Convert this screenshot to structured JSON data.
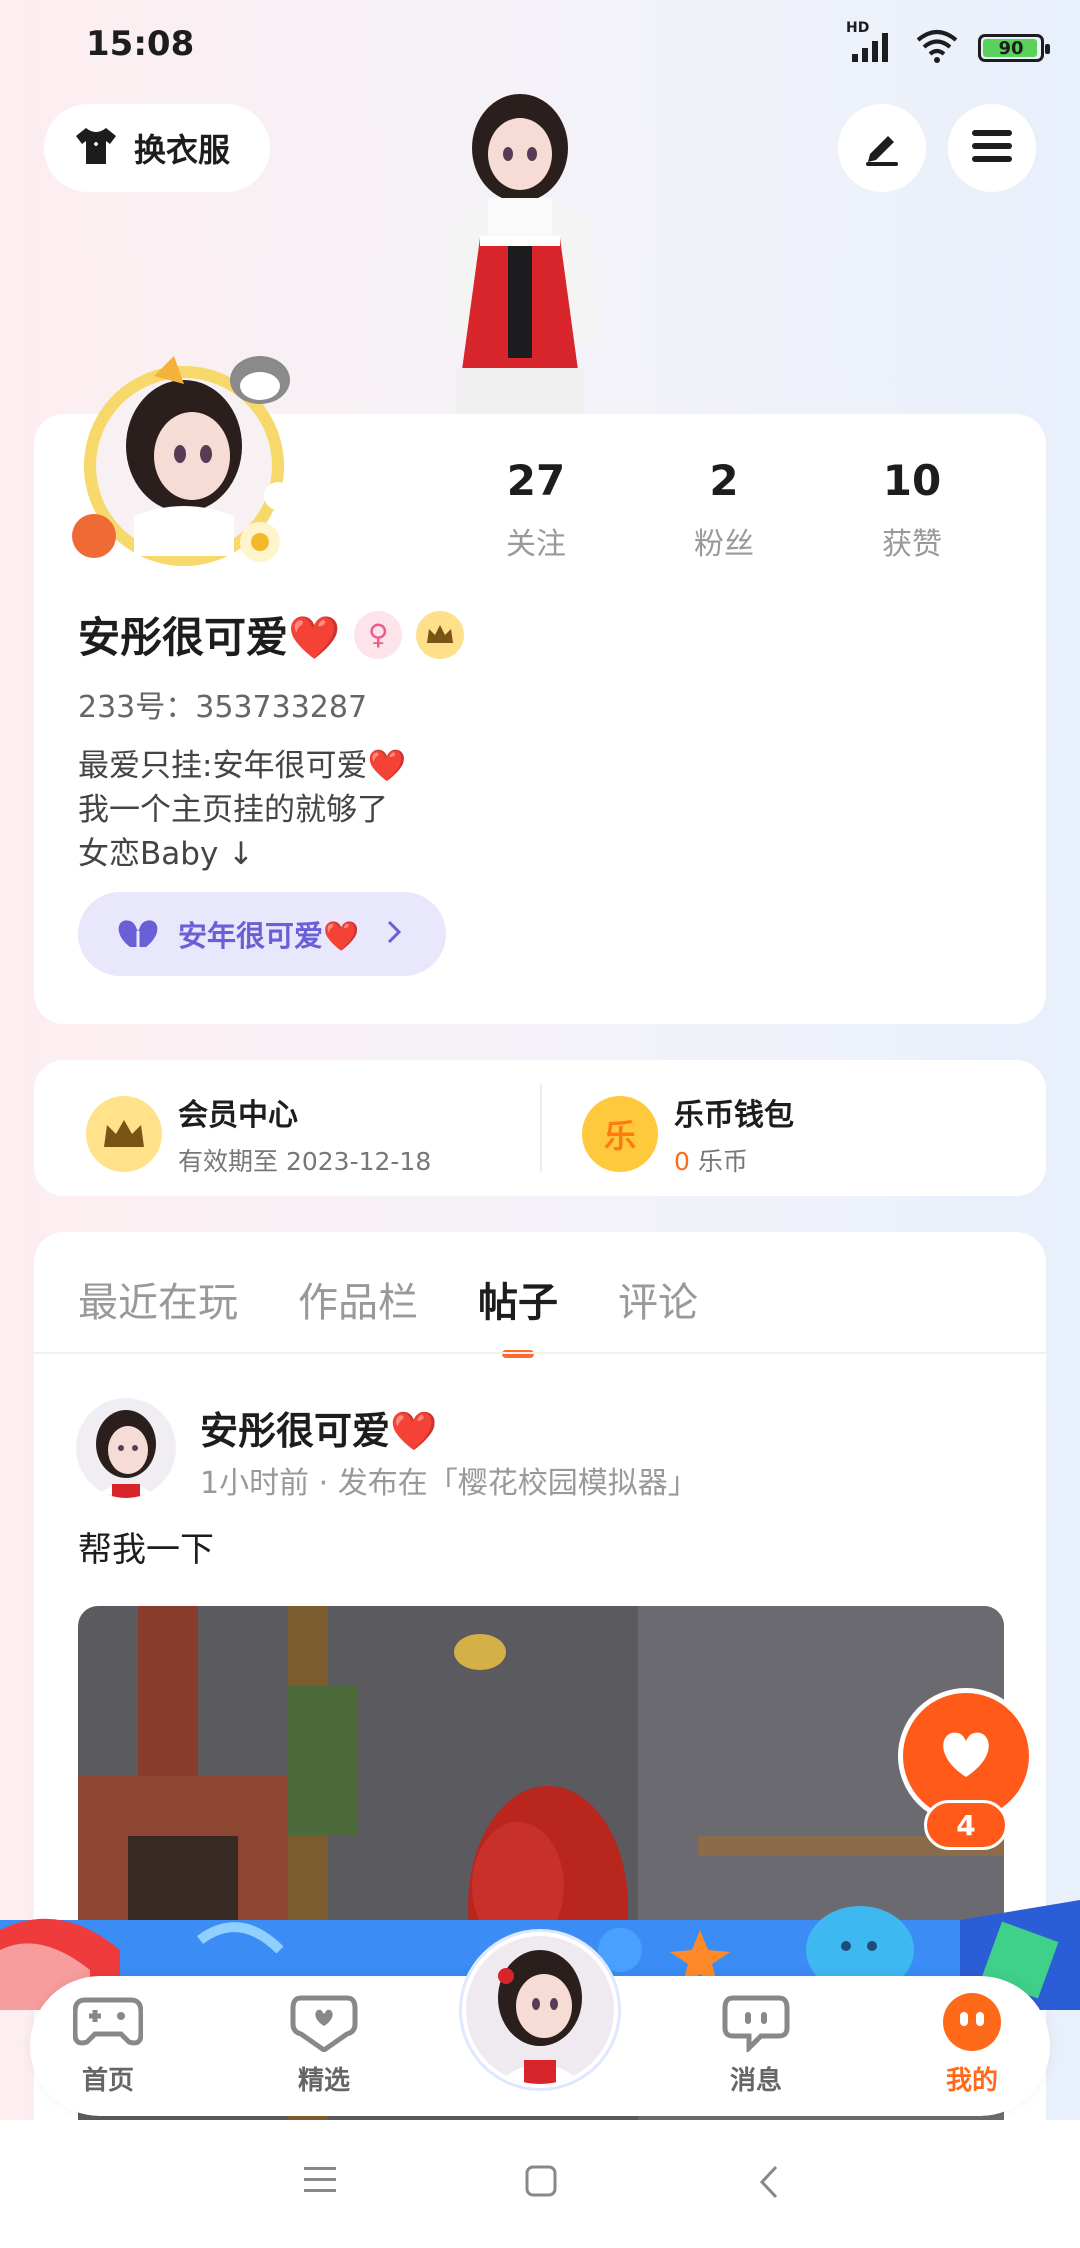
{
  "status_bar": {
    "time": "15:08",
    "battery": "90",
    "network_label": "HD"
  },
  "top_bar": {
    "outfit_label": "换衣服"
  },
  "profile": {
    "username": "安彤很可爱❤️",
    "user_id": "233号：353733287",
    "bio_lines": [
      "最爱只挂:安年很可爱❤️",
      "我一个主页挂的就够了",
      "女恋Baby ↓"
    ],
    "link_label": "安年很可爱❤️",
    "stats": [
      {
        "value": "27",
        "label": "关注"
      },
      {
        "value": "2",
        "label": "粉丝"
      },
      {
        "value": "10",
        "label": "获赞"
      }
    ]
  },
  "member": {
    "title": "会员中心",
    "subtitle": "有效期至 2023-12-18"
  },
  "wallet": {
    "title": "乐币钱包",
    "icon_text": "乐",
    "amount": "0",
    "unit": "乐币"
  },
  "tabs": [
    "最近在玩",
    "作品栏",
    "帖子",
    "评论"
  ],
  "active_tab": "帖子",
  "post": {
    "author": "安彤很可爱❤️",
    "meta": "1小时前 · 发布在「樱花校园模拟器」",
    "text": "帮我一下"
  },
  "float_like": {
    "count": "4"
  },
  "bottom_nav": [
    {
      "label": "首页",
      "icon": "gamepad-icon"
    },
    {
      "label": "精选",
      "icon": "heart-chat-icon"
    },
    {
      "label": "消息",
      "icon": "message-icon"
    },
    {
      "label": "我的",
      "icon": "face-icon"
    }
  ],
  "colors": {
    "accent": "#ff6a1a",
    "link_purple": "#6b5fd6",
    "like_orange": "#ff5a1a"
  }
}
